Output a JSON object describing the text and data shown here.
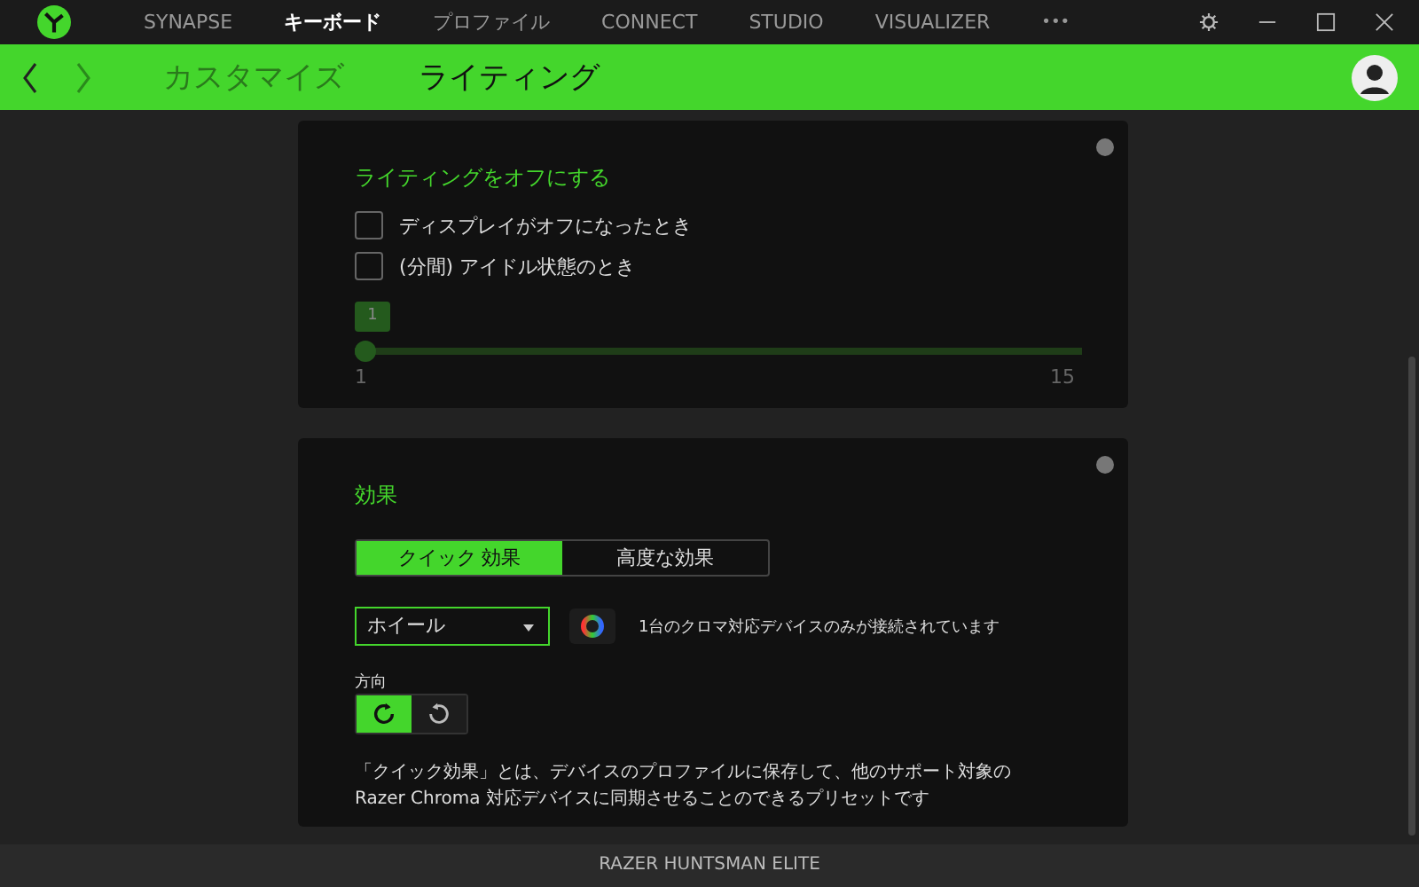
{
  "top_nav": [
    {
      "label": "SYNAPSE",
      "selected": false
    },
    {
      "label": "キーボード",
      "selected": true
    },
    {
      "label": "プロファイル",
      "selected": false
    },
    {
      "label": "CONNECT",
      "selected": false
    },
    {
      "label": "STUDIO",
      "selected": false
    },
    {
      "label": "VISUALIZER",
      "selected": false
    }
  ],
  "more": "•••",
  "sub_nav": [
    {
      "label": "カスタマイズ",
      "selected": false
    },
    {
      "label": "ライティング",
      "selected": true
    }
  ],
  "lighting_off": {
    "title": "ライティングをオフにする",
    "options": [
      {
        "label": "ディスプレイがオフになったとき",
        "checked": false
      },
      {
        "label": "(分間) アイドル状態のとき",
        "checked": false
      }
    ],
    "slider": {
      "value": "1",
      "level": 0,
      "min": "1",
      "max": "15",
      "disabled": true
    }
  },
  "effects": {
    "title": "効果",
    "tabs": [
      {
        "label": "クイック 効果",
        "selected": true
      },
      {
        "label": "高度な効果",
        "selected": false
      }
    ],
    "dropdown": "ホイール",
    "note": "1台のクロマ対応デバイスのみが接続されています",
    "direction_label": "方向",
    "directions": [
      {
        "kind": "clockwise",
        "selected": true
      },
      {
        "kind": "counterclockwise",
        "selected": false
      }
    ],
    "description": "「クイック効果」とは、デバイスのプロファイルに保存して、他のサポート対象の Razer Chroma 対応デバイスに同期させることのできるプリセットです"
  },
  "status_bar": "RAZER HUNTSMAN ELITE"
}
